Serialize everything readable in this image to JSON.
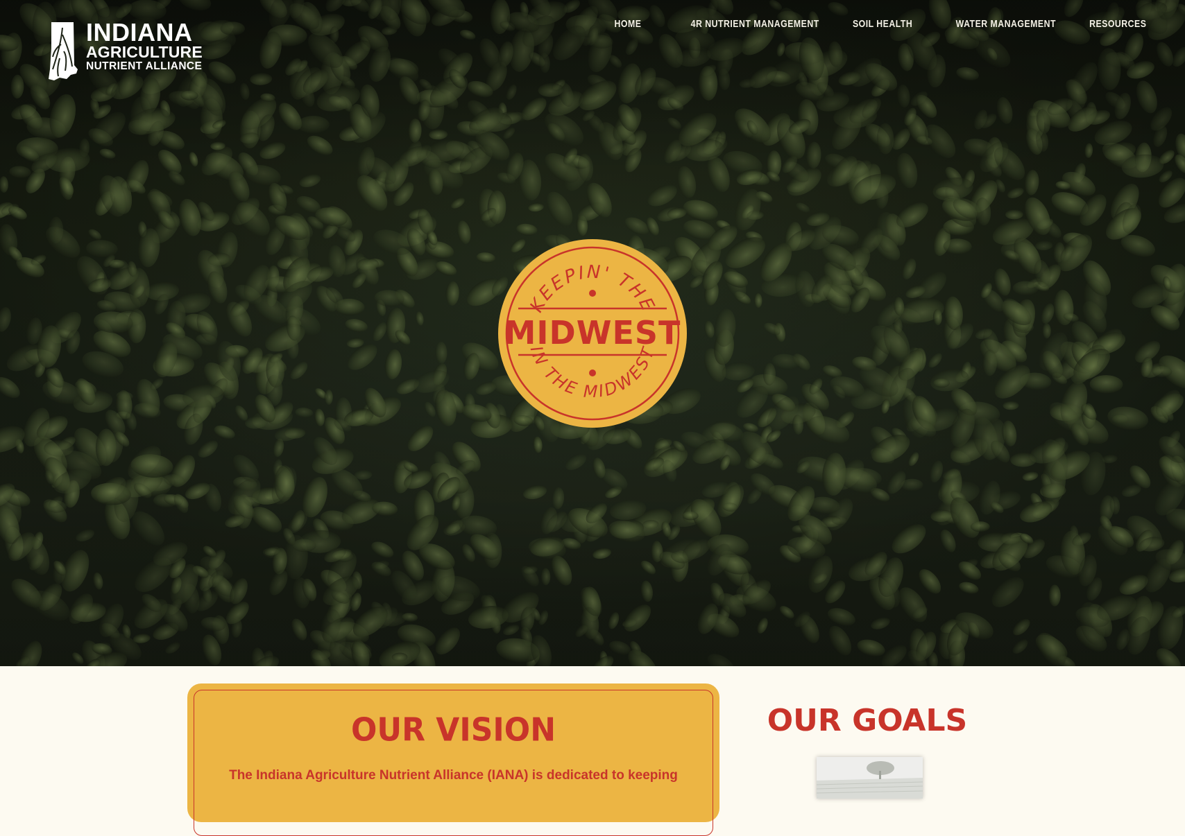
{
  "logo": {
    "line1": "INDIANA",
    "line2": "AGRICULTURE",
    "line3": "NUTRIENT ALLIANCE"
  },
  "nav": {
    "items": [
      {
        "label": "HOME"
      },
      {
        "label": "4R NUTRIENT MANAGEMENT"
      },
      {
        "label": "SOIL HEALTH"
      },
      {
        "label": "WATER MANAGEMENT"
      },
      {
        "label": "RESOURCES"
      }
    ]
  },
  "badge": {
    "top_text": "KEEPIN' THE",
    "center_text": "MIDWEST",
    "bottom_text": "IN THE MIDWEST"
  },
  "vision": {
    "title": "OUR VISION",
    "body": "The Indiana Agriculture Nutrient Alliance (IANA) is dedicated to keeping"
  },
  "goals": {
    "title": "OUR GOALS"
  },
  "colors": {
    "accent_red": "#c8342a",
    "badge_yellow": "#ecb544",
    "page_cream": "#fdfaf1"
  }
}
